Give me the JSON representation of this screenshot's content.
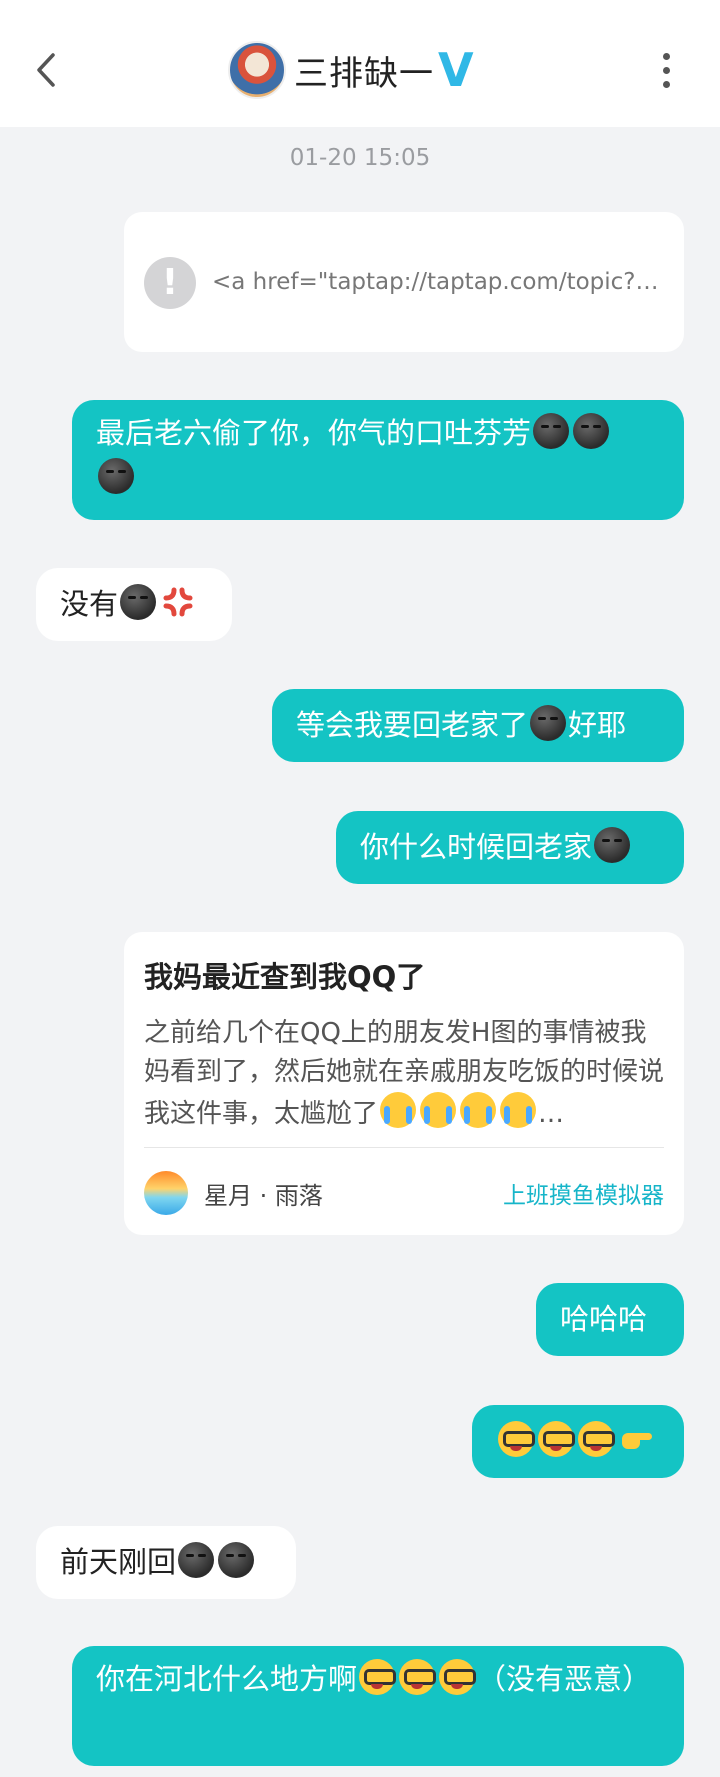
{
  "header": {
    "title": "三排缺一",
    "verified_mark": "V"
  },
  "timestamp": "01-20 15:05",
  "link_card": {
    "warning_glyph": "!",
    "text": "<a href=\"taptap://taptap.com/topic?t…"
  },
  "messages": [
    {
      "side": "out",
      "text": "最后老六偷了你，你气的口吐芬芳",
      "emoji": [
        "smirk-face",
        "smirk-face",
        "smirk-face"
      ]
    },
    {
      "side": "in",
      "text": "没有",
      "emoji": [
        "smirk-face",
        "anger-symbol"
      ]
    },
    {
      "side": "out",
      "text": "等会我要回老家了",
      "emoji_mid": "smirk-face",
      "text_after": "好耶"
    },
    {
      "side": "out",
      "text": "你什么时候回老家",
      "emoji": [
        "smirk-face"
      ]
    },
    {
      "side": "out",
      "text": "哈哈哈"
    },
    {
      "side": "out",
      "text": "",
      "emoji": [
        "nerd-face",
        "nerd-face",
        "nerd-face",
        "pointing-hand"
      ]
    },
    {
      "side": "in",
      "text": "前天刚回",
      "emoji": [
        "smirk-face",
        "smirk-face"
      ]
    },
    {
      "side": "out",
      "text": "你在河北什么地方啊",
      "emoji": [
        "nerd-face",
        "nerd-face",
        "nerd-face"
      ],
      "text_after": "（没有恶意）"
    }
  ],
  "post_card": {
    "title": "我妈最近查到我QQ了",
    "body": "之前给几个在QQ上的朋友发H图的事情被我妈看到了，然后她就在亲戚朋友吃饭的时候说我这件事，太尴尬了",
    "body_emoji": [
      "crying-face",
      "crying-face",
      "crying-face",
      "crying-face"
    ],
    "ellipsis": "…",
    "author": "星月 · 雨落",
    "game": "上班摸鱼模拟器"
  },
  "colors": {
    "outgoing_bubble": "#14c4c4",
    "incoming_bubble": "#ffffff",
    "background": "#f2f3f5",
    "verified": "#30b8e6",
    "link_accent": "#16b5c9"
  }
}
